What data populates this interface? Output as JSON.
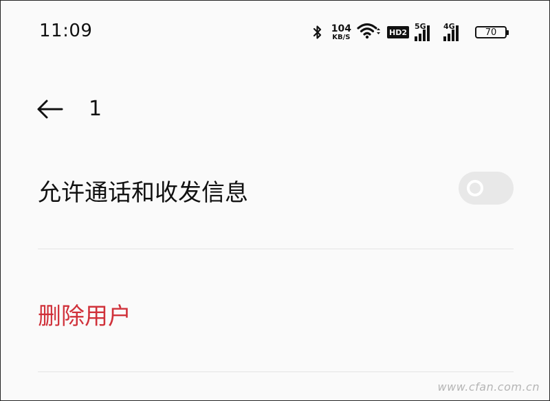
{
  "status_bar": {
    "time": "11:09",
    "network_speed_value": "104",
    "network_speed_unit": "KB/S",
    "hd_badge": "HD2",
    "signal_1_label": "5G",
    "signal_2_label": "4G",
    "battery_level": "70",
    "icons": [
      "bluetooth-icon",
      "wifi-icon",
      "signal-icon",
      "battery-icon"
    ]
  },
  "header": {
    "back_icon": "arrow-left-icon",
    "title": "1"
  },
  "settings": {
    "allow_calls_sms_label": "允许通话和收发信息",
    "allow_calls_sms_enabled": false,
    "delete_user_label": "删除用户"
  },
  "watermark": "www.cfan.com.cn",
  "colors": {
    "background": "#fafafa",
    "text": "#111111",
    "danger": "#d0313a",
    "toggle_off": "#e8e8e8"
  }
}
